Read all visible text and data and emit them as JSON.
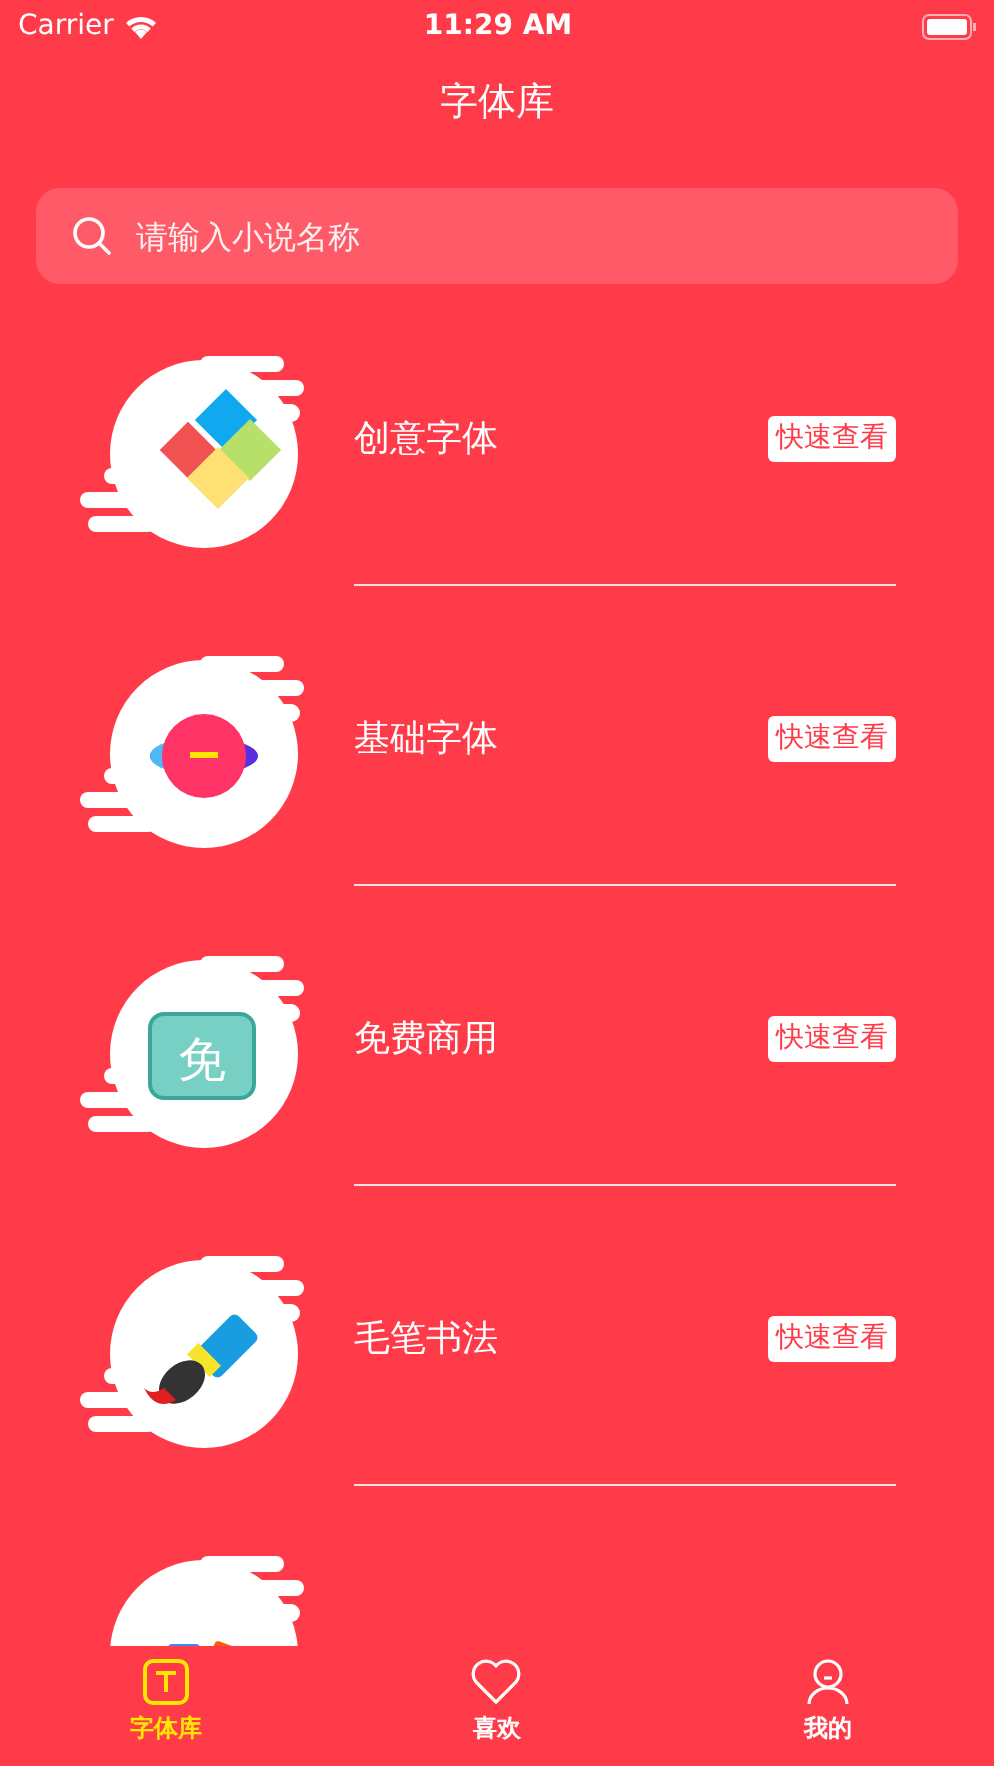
{
  "status_bar": {
    "carrier": "Carrier",
    "time": "11:29 AM"
  },
  "nav": {
    "title": "字体库"
  },
  "search": {
    "placeholder": "请输入小说名称"
  },
  "categories": [
    {
      "name": "创意字体",
      "action": "快速查看"
    },
    {
      "name": "基础字体",
      "action": "快速查看"
    },
    {
      "name": "免费商用",
      "action": "快速查看",
      "icon_text": "免"
    },
    {
      "name": "毛笔书法",
      "action": "快速查看"
    }
  ],
  "tabs": [
    {
      "label": "字体库",
      "selected": true
    },
    {
      "label": "喜欢",
      "selected": false
    },
    {
      "label": "我的",
      "selected": false
    }
  ]
}
